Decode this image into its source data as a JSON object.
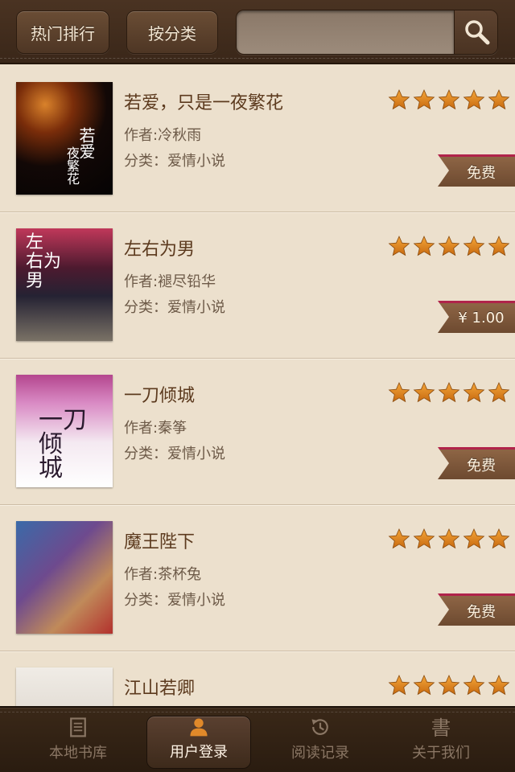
{
  "header": {
    "hot_rank_label": "热门排行",
    "by_category_label": "按分类",
    "search_placeholder": ""
  },
  "books": [
    {
      "title": "若爱，只是一夜繁花",
      "author": "作者:冷秋雨",
      "category": "分类：爱情小说",
      "rating": 5,
      "price": "免费"
    },
    {
      "title": "左右为男",
      "author": "作者:褪尽铅华",
      "category": "分类：爱情小说",
      "rating": 5,
      "price": "¥ 1.00"
    },
    {
      "title": "一刀倾城",
      "author": "作者:秦筝",
      "category": "分类：爱情小说",
      "rating": 5,
      "price": "免费"
    },
    {
      "title": "魔王陛下",
      "author": "作者:茶杯兔",
      "category": "分类：爱情小说",
      "rating": 5,
      "price": "免费"
    },
    {
      "title": "江山若卿",
      "rating": 5
    }
  ],
  "tabs": [
    {
      "label": "本地书库",
      "icon": "bookshelf-icon"
    },
    {
      "label": "用户登录",
      "icon": "user-icon",
      "active": true
    },
    {
      "label": "阅读记录",
      "icon": "history-icon"
    },
    {
      "label": "关于我们",
      "icon": "about-icon"
    }
  ],
  "colors": {
    "header_bg": "#3a2719",
    "list_bg": "#ece0cd",
    "title_text": "#5c3a1e",
    "star": "#e08a1e",
    "price_tag": "#7a5236",
    "price_tag_accent": "#b0234a"
  }
}
